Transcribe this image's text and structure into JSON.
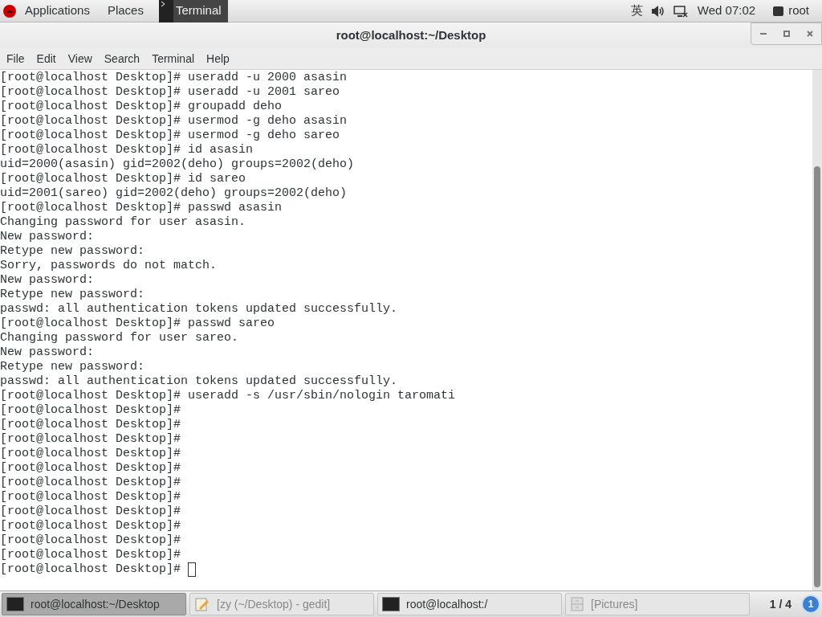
{
  "top_panel": {
    "menus": [
      "Applications",
      "Places"
    ],
    "active_app": "Terminal",
    "indicators": {
      "input_method": "英",
      "clock": "Wed 07:02",
      "user": "root"
    }
  },
  "window": {
    "title": "root@localhost:~/Desktop"
  },
  "menu_bar": [
    "File",
    "Edit",
    "View",
    "Search",
    "Terminal",
    "Help"
  ],
  "terminal": {
    "lines": [
      "[root@localhost Desktop]# useradd -u 2000 asasin",
      "[root@localhost Desktop]# useradd -u 2001 sareo",
      "[root@localhost Desktop]# groupadd deho",
      "[root@localhost Desktop]# usermod -g deho asasin",
      "[root@localhost Desktop]# usermod -g deho sareo",
      "[root@localhost Desktop]# id asasin",
      "uid=2000(asasin) gid=2002(deho) groups=2002(deho)",
      "[root@localhost Desktop]# id sareo",
      "uid=2001(sareo) gid=2002(deho) groups=2002(deho)",
      "[root@localhost Desktop]# passwd asasin",
      "Changing password for user asasin.",
      "New password:",
      "Retype new password:",
      "Sorry, passwords do not match.",
      "New password:",
      "Retype new password:",
      "passwd: all authentication tokens updated successfully.",
      "[root@localhost Desktop]# passwd sareo",
      "Changing password for user sareo.",
      "New password:",
      "Retype new password:",
      "passwd: all authentication tokens updated successfully.",
      "[root@localhost Desktop]# useradd -s /usr/sbin/nologin taromati",
      "[root@localhost Desktop]#",
      "[root@localhost Desktop]#",
      "[root@localhost Desktop]#",
      "[root@localhost Desktop]#",
      "[root@localhost Desktop]#",
      "[root@localhost Desktop]#",
      "[root@localhost Desktop]#",
      "[root@localhost Desktop]#",
      "[root@localhost Desktop]#",
      "[root@localhost Desktop]#",
      "[root@localhost Desktop]#",
      "[root@localhost Desktop]#"
    ],
    "cursor_visible": true
  },
  "taskbar": {
    "items": [
      {
        "label": "root@localhost:~/Desktop",
        "kind": "terminal",
        "selected": true
      },
      {
        "label": "[zy (~/Desktop) - gedit]",
        "kind": "editor",
        "selected": false
      },
      {
        "label": "root@localhost:/",
        "kind": "terminal",
        "selected": false
      },
      {
        "label": "[Pictures]",
        "kind": "files",
        "selected": false
      }
    ],
    "workspace": "1 / 4",
    "notifications": "1"
  }
}
